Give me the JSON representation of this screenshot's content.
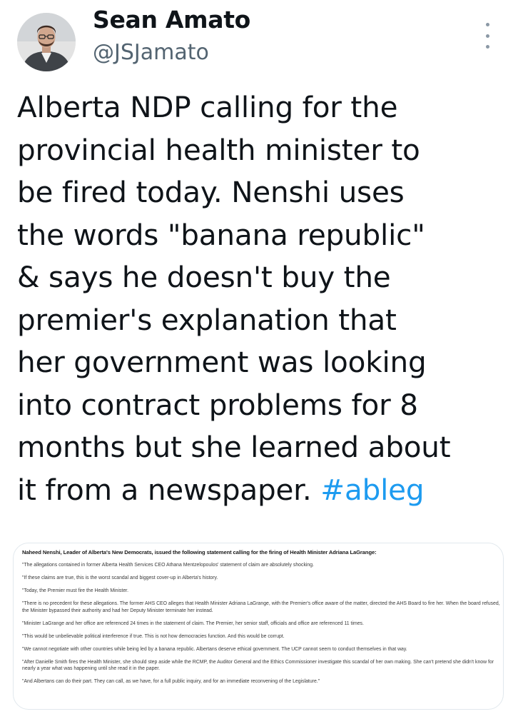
{
  "author": {
    "name": "Sean Amato",
    "handle": "@JSJamato",
    "avatar_icon": "profile-photo"
  },
  "more_icon": "more-options-icon",
  "tweet": {
    "lines": [
      "Alberta NDP calling for the",
      "provincial health minister to",
      "be fired today. Nenshi uses",
      "the words \"banana republic\"",
      "& says he doesn't buy the",
      "premier's explanation that",
      "her government was looking",
      "into contract problems for 8",
      "months but she learned about",
      "it from a newspaper. "
    ],
    "hashtag": "#ableg"
  },
  "media": {
    "heading": "Naheed Nenshi, Leader of Alberta's New Democrats, issued the following statement calling for the firing of Health Minister Adriana LaGrange:",
    "paragraphs": [
      "\"The allegations contained in former Alberta Health Services CEO Athana Mentzelopoulos' statement of claim are absolutely shocking.",
      "\"If these claims are true, this is the worst scandal and biggest cover-up in Alberta's history.",
      "\"Today, the Premier must fire the Health Minister.",
      "\"There is no precedent for these allegations. The former AHS CEO alleges that Health Minister Adriana LaGrange, with the Premier's office aware of the matter, directed the AHS Board to fire her. When the board refused, the Minister bypassed their authority and had her Deputy Minister terminate her instead.",
      "\"Minister LaGrange and her office are referenced 24 times in the statement of claim. The Premier, her senior staff, officials and office are referenced 11 times.",
      "\"This would be unbelievable political interference if true. This is not how democracies function. And this would be corrupt.",
      "\"We cannot negotiate with other countries while being led by a banana republic. Albertans deserve ethical government. The UCP cannot seem to conduct themselves in that way.",
      "\"After Danielle Smith fires the Health Minister, she should step aside while the RCMP, the Auditor General and the Ethics Commissioner investigate this scandal of her own making. She can't pretend she didn't know for nearly a year what was happening until she read it in the paper.",
      "\"And Albertans can do their part. They can call, as we have, for a full public inquiry, and for an immediate reconvening of the Legislature.\""
    ]
  },
  "colors": {
    "text": "#0f1419",
    "secondary": "#536471",
    "link": "#1d9bf0",
    "border": "#e1e8ed"
  }
}
